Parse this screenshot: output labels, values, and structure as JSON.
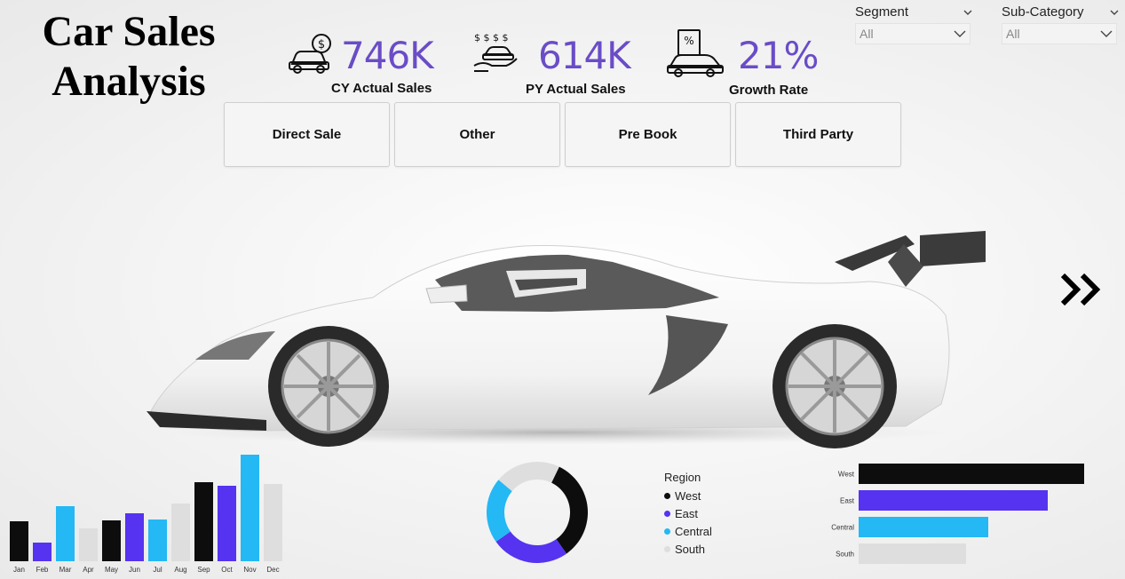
{
  "title_line1": "Car Sales",
  "title_line2": "Analysis",
  "kpis": [
    {
      "value": "746K",
      "label": "CY Actual Sales",
      "icon": "car-money-icon"
    },
    {
      "value": "614K",
      "label": "PY Actual Sales",
      "icon": "hand-car-money-icon"
    },
    {
      "value": "21%",
      "label": "Growth Rate",
      "icon": "car-document-percent-icon"
    }
  ],
  "slicers": {
    "segment": {
      "title": "Segment",
      "value": "All"
    },
    "subcategory": {
      "title": "Sub-Category",
      "value": "All"
    }
  },
  "buttons": [
    "Direct Sale",
    "Other",
    "Pre Book",
    "Third Party"
  ],
  "colors": {
    "accent": "#6a4cc7",
    "black": "#0d0d0d",
    "purple": "#5533f0",
    "cyan": "#24b8f4",
    "grey": "#dedede"
  },
  "chart_data": [
    {
      "type": "bar",
      "categories": [
        "Jan",
        "Feb",
        "Mar",
        "Apr",
        "May",
        "Jun",
        "Jul",
        "Aug",
        "Sep",
        "Oct",
        "Nov",
        "Dec"
      ],
      "values": [
        45,
        21,
        62,
        37,
        46,
        54,
        47,
        65,
        89,
        85,
        120,
        87
      ],
      "colors": [
        "#0d0d0d",
        "#5533f0",
        "#24b8f4",
        "#dedede",
        "#0d0d0d",
        "#5533f0",
        "#24b8f4",
        "#dedede",
        "#0d0d0d",
        "#5533f0",
        "#24b8f4",
        "#dedede"
      ]
    },
    {
      "type": "pie",
      "legend_title": "Region",
      "labels": [
        "West",
        "East",
        "Central",
        "South"
      ],
      "values": [
        33,
        25,
        21,
        21
      ],
      "colors": [
        "#0d0d0d",
        "#5533f0",
        "#24b8f4",
        "#dedede"
      ]
    },
    {
      "type": "bar",
      "orientation": "horizontal",
      "categories": [
        "West",
        "East",
        "Central",
        "South"
      ],
      "values": [
        254,
        213,
        146,
        121
      ],
      "colors": [
        "#0d0d0d",
        "#5533f0",
        "#24b8f4",
        "#dedede"
      ]
    }
  ]
}
